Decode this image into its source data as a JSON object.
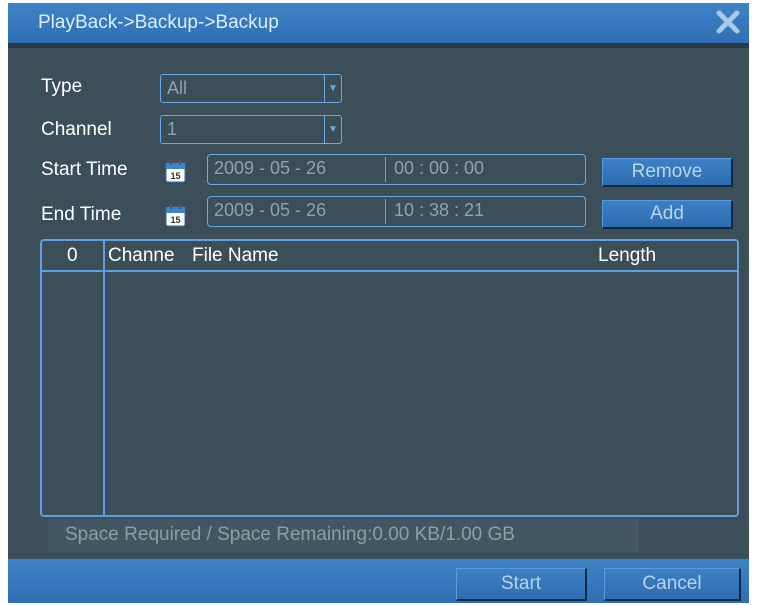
{
  "window": {
    "title": "PlayBack->Backup->Backup",
    "close_icon": "close-x-icon"
  },
  "form": {
    "type_label": "Type",
    "type_value": "All",
    "channel_label": "Channel",
    "channel_value": "1",
    "start_time_label": "Start Time",
    "start_date": "2009  - 05 - 26",
    "start_clock": "00 :  00 :  00",
    "end_time_label": "End Time",
    "end_date": "2009  - 05 - 26",
    "end_clock": "10 :  38 :  21",
    "calendar_icon_text": "15"
  },
  "buttons": {
    "remove": "Remove",
    "add": "Add",
    "start": "Start",
    "cancel": "Cancel"
  },
  "table": {
    "columns": [
      "0",
      "Channe",
      "File Name",
      "Length"
    ],
    "rows": []
  },
  "status": {
    "text": "Space Required / Space Remaining:0.00 KB/1.00 GB"
  },
  "colors": {
    "window_bg": "#3c4f58",
    "bar_blue": "#3579bd",
    "border_blue": "#6aa9e6"
  }
}
